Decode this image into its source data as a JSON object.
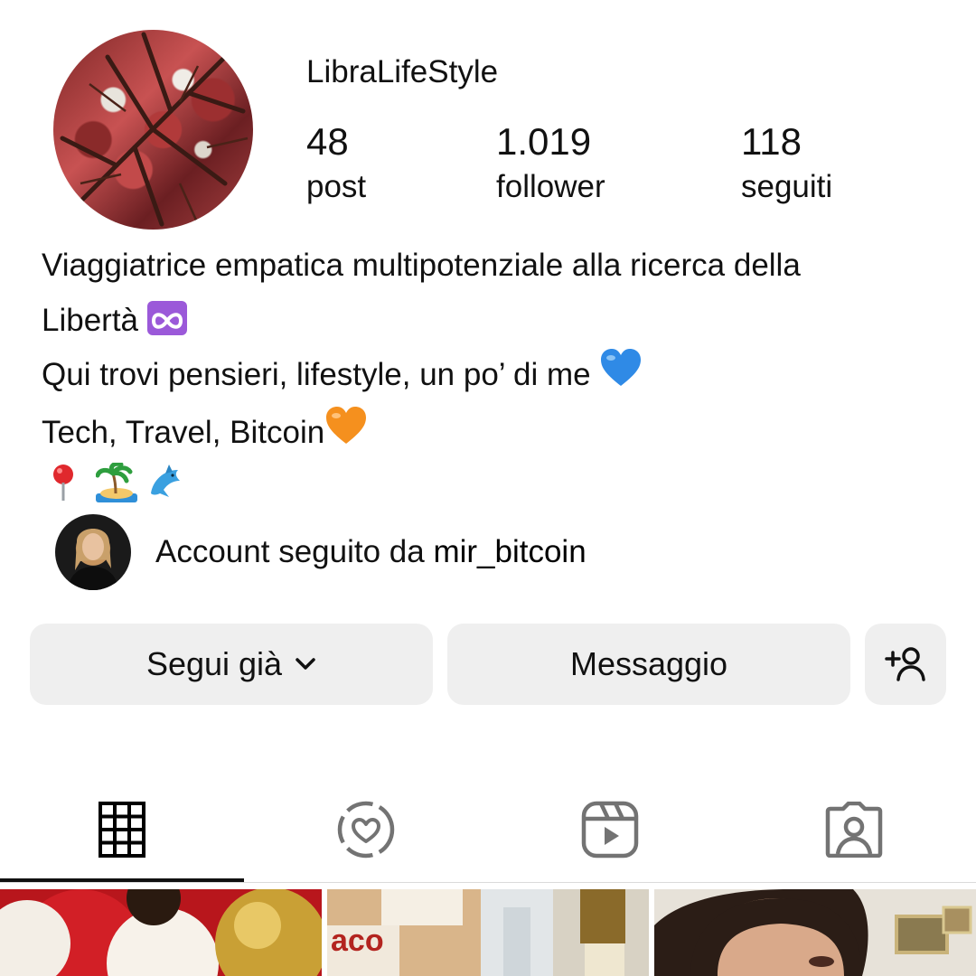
{
  "profile": {
    "username": "LibraLifeStyle",
    "stats": [
      {
        "value": "48",
        "label": "post"
      },
      {
        "value": "1.019",
        "label": "follower"
      },
      {
        "value": "118",
        "label": "seguiti"
      }
    ],
    "bio": {
      "line1": "Viaggiatrice empatica multipotenziale alla ricerca della",
      "line2": "Libertà",
      "line3": "Qui trovi pensieri, lifestyle, un po’ di me",
      "line4": "Tech, Travel, Bitcoin"
    },
    "followed_by": {
      "prefix": "Account seguito da",
      "username": "mir_bitcoin"
    }
  },
  "actions": {
    "following_label": "Segui già",
    "message_label": "Messaggio"
  },
  "tabs": [
    {
      "icon": "grid-icon",
      "active": true
    },
    {
      "icon": "reposts-icon",
      "active": false
    },
    {
      "icon": "reels-icon",
      "active": false
    },
    {
      "icon": "tagged-icon",
      "active": false
    }
  ],
  "colors": {
    "button_bg": "#efefef",
    "active_tab": "#111111",
    "inactive_icon": "#737373",
    "heart_blue": "#2f8ae6",
    "heart_orange": "#f5901e"
  }
}
